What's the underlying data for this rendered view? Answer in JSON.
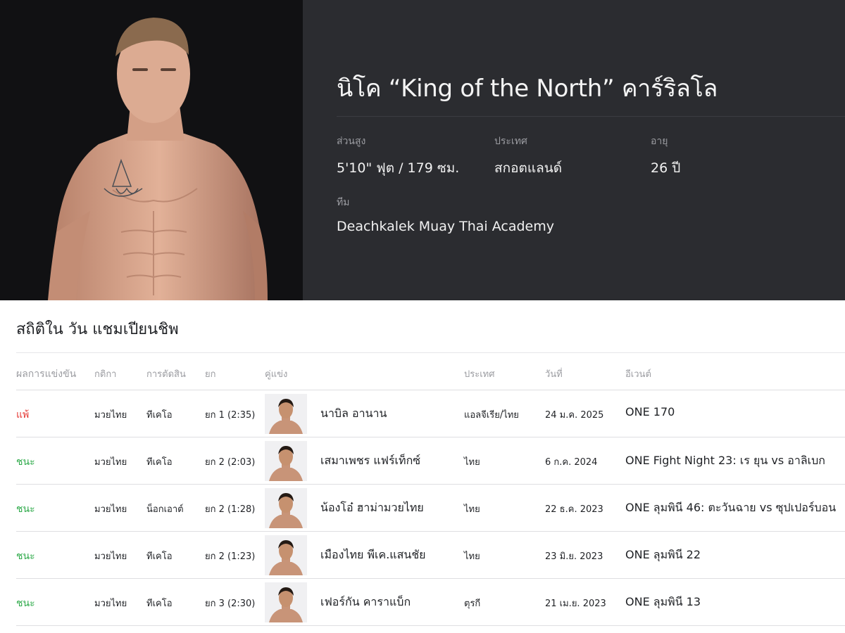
{
  "fighter": {
    "name": "นิโค “King of the North” คาร์ริลโล",
    "stats": {
      "height": {
        "label": "ส่วนสูง",
        "value": "5'10\" ฟุต / 179 ซม."
      },
      "country": {
        "label": "ประเทศ",
        "value": "สกอตแลนด์"
      },
      "age": {
        "label": "อายุ",
        "value": "26 ปี"
      },
      "team": {
        "label": "ทีม",
        "value": "Deachkalek Muay Thai Academy"
      }
    }
  },
  "record": {
    "title": "สถิติใน วัน แชมเปียนชิพ",
    "headers": {
      "result": "ผลการแข่งขัน",
      "sport": "กติกา",
      "method": "การตัดสิน",
      "round": "ยก",
      "opponent": "คู่แข่ง",
      "country": "ประเทศ",
      "date": "วันที่",
      "event": "อีเวนต์"
    },
    "rows": [
      {
        "result": "แพ้",
        "result_type": "loss",
        "sport": "มวยไทย",
        "method": "ทีเคโอ",
        "round": "ยก 1 (2:35)",
        "opponent": "นาบิล อานาน",
        "country": "แอลจีเรีย/ไทย",
        "date": "24 ม.ค. 2025",
        "event": "ONE 170"
      },
      {
        "result": "ชนะ",
        "result_type": "win",
        "sport": "มวยไทย",
        "method": "ทีเคโอ",
        "round": "ยก 2 (2:03)",
        "opponent": "เสมาเพชร แฟร์เท็กซ์",
        "country": "ไทย",
        "date": "6 ก.ค. 2024",
        "event": "ONE Fight Night 23: เร ยุน vs อาลิเบก"
      },
      {
        "result": "ชนะ",
        "result_type": "win",
        "sport": "มวยไทย",
        "method": "น็อกเอาต์",
        "round": "ยก 2 (1:28)",
        "opponent": "น้องโอ๋ ฮาม่ามวยไทย",
        "country": "ไทย",
        "date": "22 ธ.ค. 2023",
        "event": "ONE ลุมพินี 46: ตะวันฉาย vs ซุปเปอร์บอน"
      },
      {
        "result": "ชนะ",
        "result_type": "win",
        "sport": "มวยไทย",
        "method": "ทีเคโอ",
        "round": "ยก 2 (1:23)",
        "opponent": "เมืองไทย พีเค.แสนชัย",
        "country": "ไทย",
        "date": "23 มิ.ย. 2023",
        "event": "ONE ลุมพินี 22"
      },
      {
        "result": "ชนะ",
        "result_type": "win",
        "sport": "มวยไทย",
        "method": "ทีเคโอ",
        "round": "ยก 3 (2:30)",
        "opponent": "เฟอร์กัน คาราแบ็ก",
        "country": "ตุรกี",
        "date": "21 เม.ย. 2023",
        "event": "ONE ลุมพินี 13"
      }
    ]
  },
  "colors": {
    "hero_bg": "#2b2c30",
    "photo_bg": "#111113",
    "loss": "#e53935",
    "win": "#2eaa4a",
    "label_gray": "#9b9ca1"
  }
}
